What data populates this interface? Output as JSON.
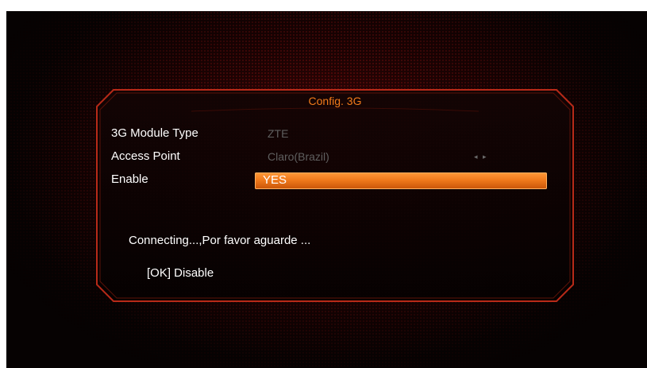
{
  "dialog": {
    "title": "Config. 3G",
    "rows": [
      {
        "label": "3G Module Type",
        "value": "ZTE"
      },
      {
        "label": "Access Point",
        "value": "Claro(Brazil)",
        "arrows": "◂ ▸"
      },
      {
        "label": "Enable",
        "value": "YES"
      }
    ],
    "status_message": "Connecting...,Por favor aguarde ...",
    "ok_hint": "[OK] Disable"
  },
  "colors": {
    "accent": "#f27a1a",
    "frame": "#c0281a",
    "label": "#ffffff",
    "value_disabled": "#5f5f5f",
    "background": "#060202"
  },
  "icons": {
    "access_point_arrows": "left-right-arrows-icon"
  }
}
